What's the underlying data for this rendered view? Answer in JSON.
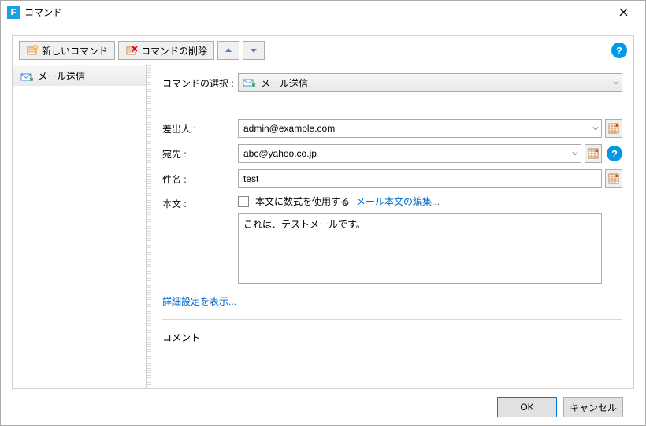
{
  "window": {
    "title": "コマンド"
  },
  "toolbar": {
    "new_label": "新しいコマンド",
    "delete_label": "コマンドの削除"
  },
  "sidebar": {
    "items": [
      {
        "label": "メール送信"
      }
    ]
  },
  "main": {
    "command_select_label": "コマンドの選択 :",
    "command_select_value": "メール送信",
    "from_label": "差出人 :",
    "from_value": "admin@example.com",
    "to_label": "宛先 :",
    "to_value": "abc@yahoo.co.jp",
    "subject_label": "件名 :",
    "subject_value": "test",
    "body_label": "本文 :",
    "use_formula_label": "本文に数式を使用する",
    "edit_body_link": "メール本文の編集...",
    "body_value": "これは、テストメールです。",
    "advanced_link": "詳細設定を表示...",
    "comment_label": "コメント",
    "comment_value": ""
  },
  "buttons": {
    "ok": "OK",
    "cancel": "キャンセル"
  }
}
